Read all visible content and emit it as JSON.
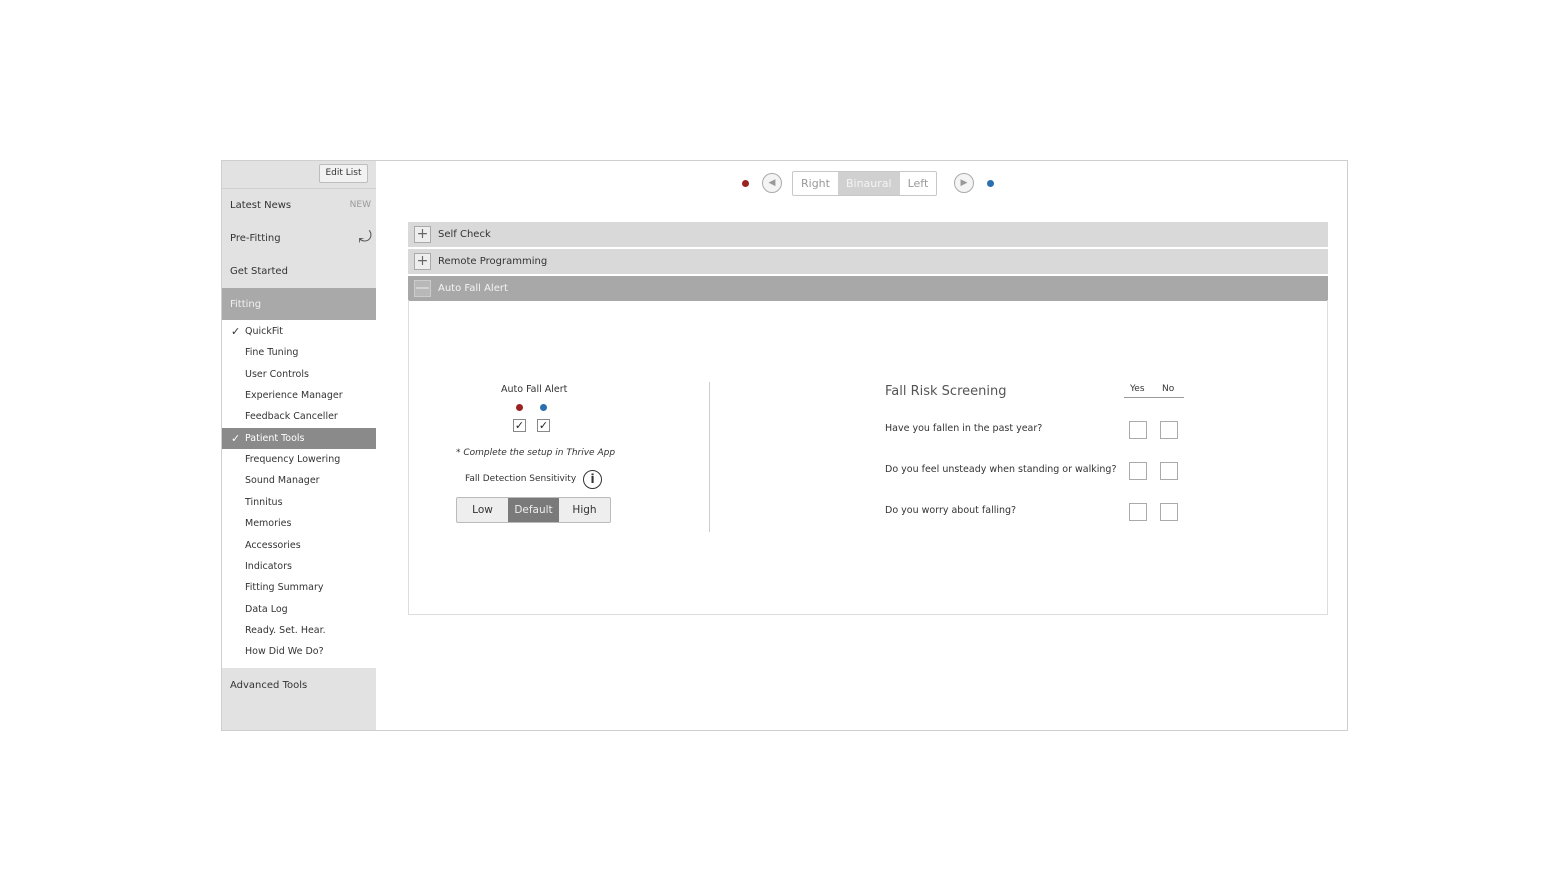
{
  "sidebar": {
    "edit_list": "Edit List",
    "latest_news": "Latest News",
    "new_badge": "NEW",
    "pre_fitting": "Pre-Fitting",
    "get_started": "Get Started",
    "fitting": "Fitting",
    "items": [
      {
        "label": "QuickFit",
        "checked": true,
        "active": false
      },
      {
        "label": "Fine Tuning"
      },
      {
        "label": "User Controls"
      },
      {
        "label": "Experience Manager"
      },
      {
        "label": "Feedback Canceller"
      },
      {
        "label": "Patient Tools",
        "checked": true,
        "active": true
      },
      {
        "label": "Frequency Lowering"
      },
      {
        "label": "Sound Manager"
      },
      {
        "label": "Tinnitus"
      },
      {
        "label": "Memories"
      },
      {
        "label": "Accessories"
      },
      {
        "label": "Indicators"
      },
      {
        "label": "Fitting Summary"
      },
      {
        "label": "Data Log"
      },
      {
        "label": "Ready. Set. Hear."
      },
      {
        "label": "How Did We Do?"
      }
    ],
    "advanced_tools": "Advanced Tools"
  },
  "ear_selector": {
    "options": [
      "Right",
      "Binaural",
      "Left"
    ],
    "selected": "Binaural"
  },
  "accordion": [
    {
      "label": "Self Check",
      "open": false
    },
    {
      "label": "Remote Programming",
      "open": false
    },
    {
      "label": "Auto Fall Alert",
      "open": true
    }
  ],
  "fall_alert": {
    "title": "Auto Fall Alert",
    "right_checked": true,
    "left_checked": true,
    "note": "* Complete the setup in Thrive App",
    "sensitivity_label": "Fall Detection Sensitivity",
    "sensitivity_options": [
      "Low",
      "Default",
      "High"
    ],
    "sensitivity_selected": "Default"
  },
  "screening": {
    "title": "Fall Risk Screening",
    "yes": "Yes",
    "no": "No",
    "questions": [
      "Have you fallen in the past year?",
      "Do you feel unsteady when standing or walking?",
      "Do you worry about falling?"
    ]
  }
}
